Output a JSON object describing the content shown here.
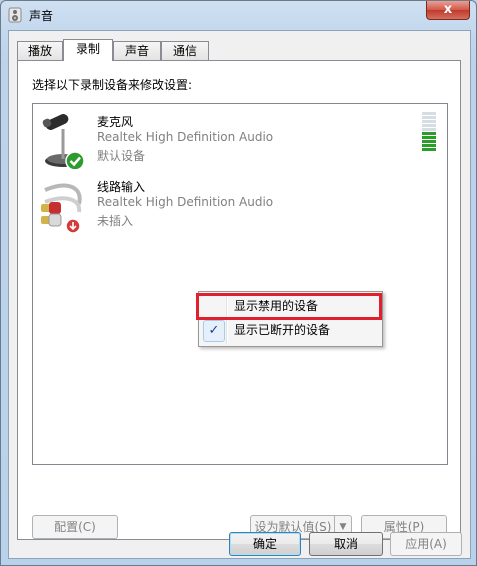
{
  "window": {
    "title": "声音",
    "close_label": "x"
  },
  "tabs": [
    {
      "label": "播放"
    },
    {
      "label": "录制"
    },
    {
      "label": "声音"
    },
    {
      "label": "通信"
    }
  ],
  "recording": {
    "instruction": "选择以下录制设备来修改设置:",
    "devices": [
      {
        "name": "麦克风",
        "driver": "Realtek High Definition Audio",
        "status": "默认设备",
        "icon": "microphone-icon",
        "badge": "default-check-icon",
        "level_meter": {
          "total_bars": 10,
          "active_bars": 5,
          "active_color": "#2a9d2a"
        }
      },
      {
        "name": "线路输入",
        "driver": "Realtek High Definition Audio",
        "status": "未插入",
        "icon": "line-in-cable-icon",
        "badge": "unplugged-arrow-icon"
      }
    ]
  },
  "context_menu": {
    "items": [
      {
        "label": "显示禁用的设备",
        "checked": false,
        "highlighted": true
      },
      {
        "label": "显示已断开的设备",
        "checked": true
      }
    ],
    "highlight_color": "#e0202e"
  },
  "panel_buttons": {
    "configure": "配置(C)",
    "set_default": "设为默认值(S)",
    "properties": "属性(P)"
  },
  "dialog_buttons": {
    "ok": "确定",
    "cancel": "取消",
    "apply": "应用(A)"
  }
}
